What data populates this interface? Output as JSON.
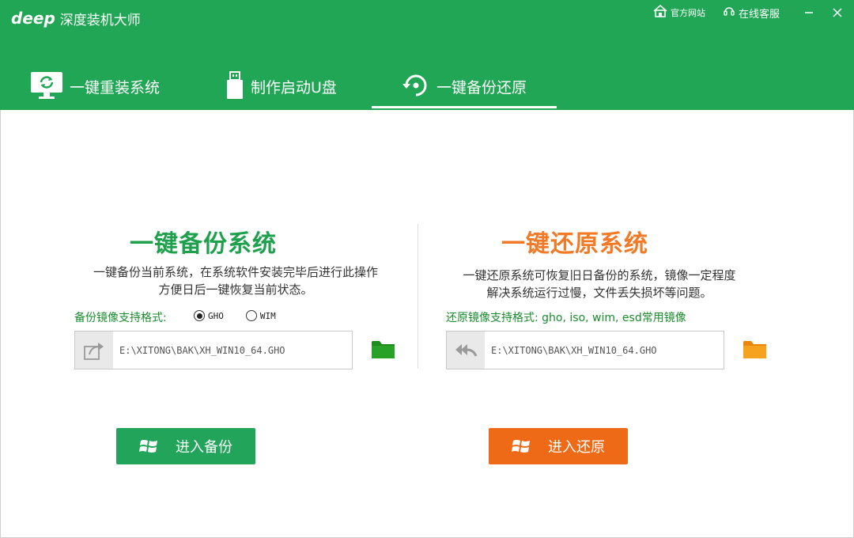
{
  "app": {
    "logo_text": "deep",
    "name": "深度装机大师"
  },
  "toplinks": {
    "site": "官方网站",
    "support": "在线客服"
  },
  "tabs": [
    {
      "label": "一键重装系统",
      "icon": "monitor-refresh-icon"
    },
    {
      "label": "制作启动U盘",
      "icon": "usb-drive-icon"
    },
    {
      "label": "一键备份还原",
      "icon": "backup-restore-icon"
    }
  ],
  "active_tab": 2,
  "backup": {
    "title": "一键备份系统",
    "desc_line1": "一键备份当前系统，在系统软件安装完毕后进行此操作",
    "desc_line2": "方便日后一键恢复当前状态。",
    "format_label": "备份镜像支持格式:",
    "options": [
      {
        "label": "GHO",
        "selected": true
      },
      {
        "label": "WIM",
        "selected": false
      }
    ],
    "path_value": "E:\\XITONG\\BAK\\XH_WIN10_64.GHO",
    "button_label": "进入备份"
  },
  "restore": {
    "title": "一键还原系统",
    "desc_line1": "一键还原系统可恢复旧日备份的系统，镜像一定程度",
    "desc_line2": "解决系统运行过慢，文件丢失损坏等问题。",
    "format_label": "还原镜像支持格式: gho, iso, wim, esd常用镜像",
    "path_value": "E:\\XITONG\\BAK\\XH_WIN10_64.GHO",
    "button_label": "进入还原"
  },
  "colors": {
    "brand_green": "#21a655",
    "accent_orange": "#ee6a17",
    "heading_green": "#1ea04c",
    "heading_orange": "#f27a26"
  }
}
